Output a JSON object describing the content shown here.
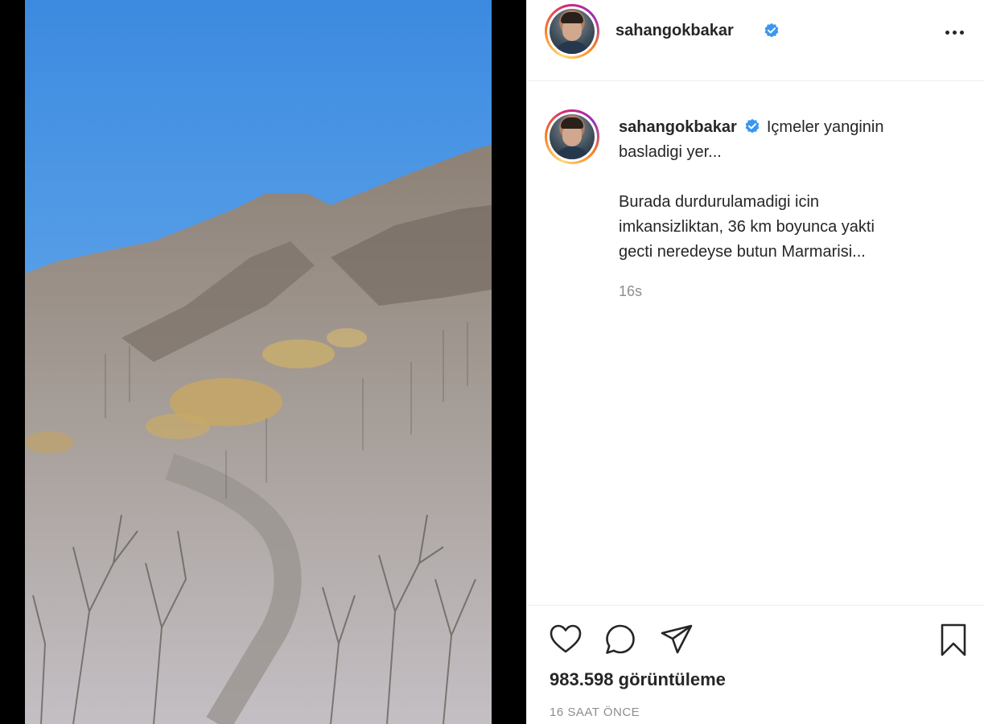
{
  "post": {
    "username": "sahangokbakar",
    "caption_username": "sahangokbakar",
    "caption_first": "Içmeler yanginin",
    "caption_first_cont": "basladigi yer...",
    "caption_body_1": "Burada durdurulamadigi icin",
    "caption_body_2": "imkansizliktan, 36 km boyunca yakti",
    "caption_body_3": "gecti neredeyse butun Marmarisi...",
    "caption_age": "16s",
    "views": "983.598 görüntüleme",
    "posted": "16 SAAT ÖNCE"
  },
  "icons": {
    "verified": "verified-badge-icon",
    "more": "more-options-icon",
    "like": "heart-icon",
    "comment": "comment-bubble-icon",
    "share": "paper-plane-icon",
    "save": "bookmark-icon"
  },
  "colors": {
    "verified_blue": "#3897f0",
    "text": "#262626",
    "muted": "#8e8e8e",
    "divider": "#efefef"
  }
}
